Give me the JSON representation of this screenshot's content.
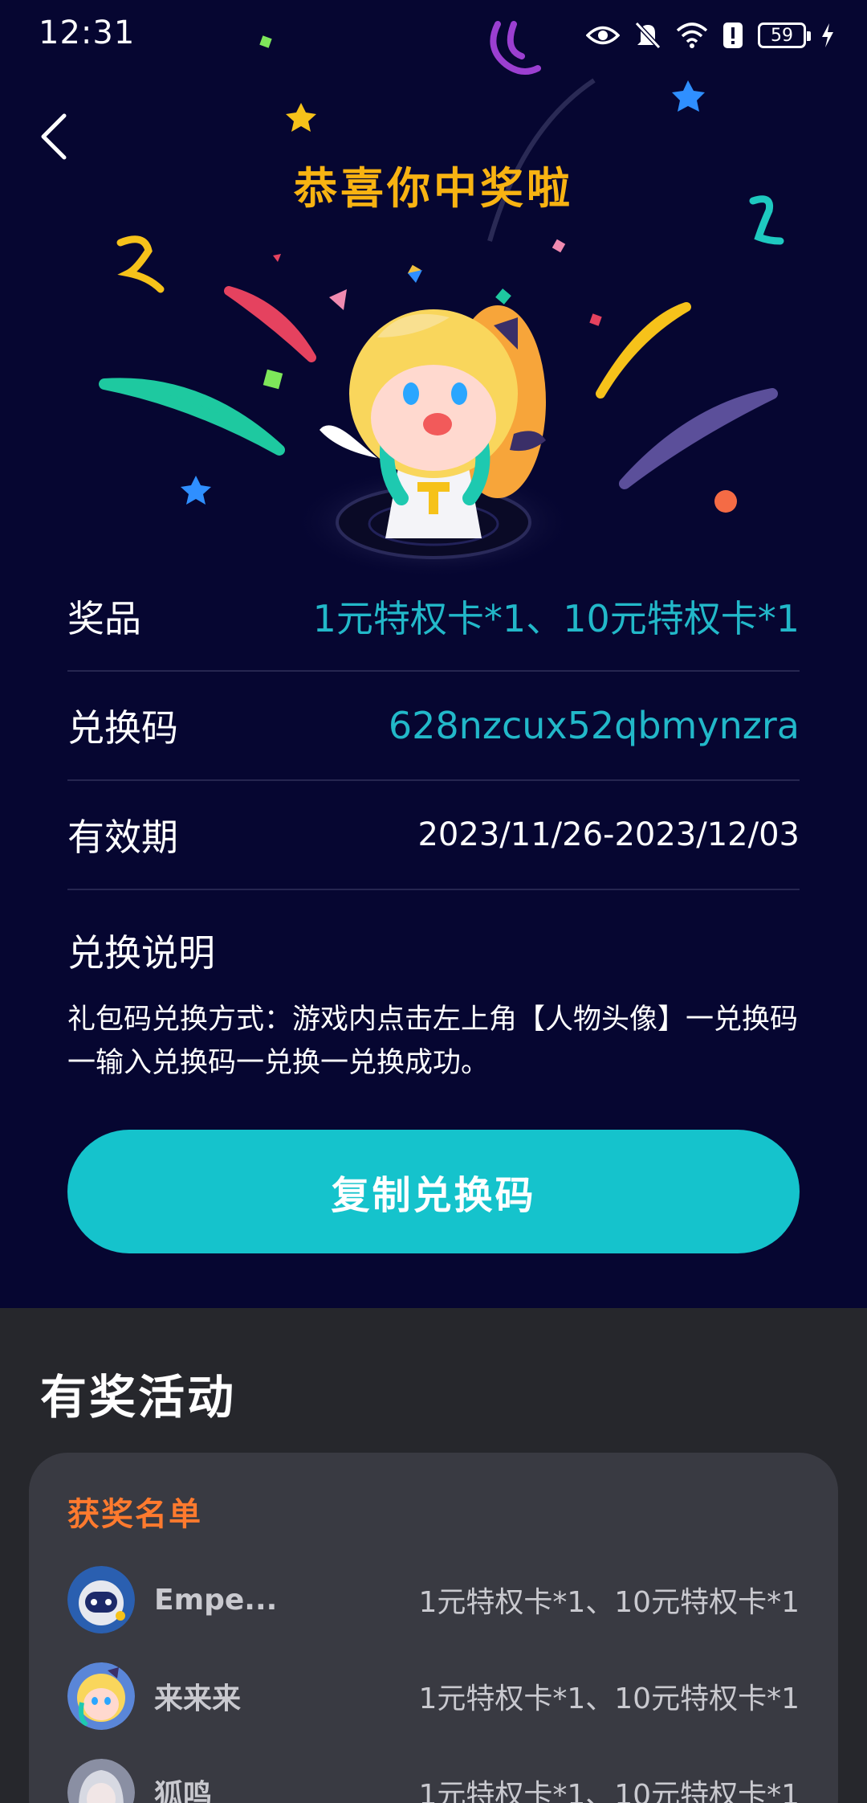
{
  "status_bar": {
    "time": "12:31",
    "battery": "59",
    "icons": [
      "eye-icon",
      "bell-muted-icon",
      "wifi-icon",
      "alert-icon",
      "battery-icon",
      "charging-icon"
    ]
  },
  "header": {
    "title": "恭喜你中奖啦"
  },
  "prize_info": {
    "prize_label": "奖品",
    "prize_value": "1元特权卡*1、10元特权卡*1",
    "code_label": "兑换码",
    "code_value": "628nzcux52qbmynzra",
    "validity_label": "有效期",
    "validity_value": "2023/11/26-2023/12/03",
    "instructions_title": "兑换说明",
    "instructions_text": "礼包码兑换方式：游戏内点击左上角【人物头像】一兑换码一输入兑换码一兑换一兑换成功。"
  },
  "copy_button_label": "复制兑换码",
  "activities": {
    "title": "有奖活动",
    "winners_title": "获奖名单",
    "winners": [
      {
        "name": "Empe...",
        "prize": "1元特权卡*1、10元特权卡*1"
      },
      {
        "name": "来来来",
        "prize": "1元特权卡*1、10元特权卡*1"
      },
      {
        "name": "狐鸣",
        "prize": "1元特权卡*1、10元特权卡*1"
      }
    ]
  },
  "colors": {
    "background": "#060631",
    "title_gold": "#f8b312",
    "accent_teal": "#15c3cc",
    "value_teal": "#22b8c9",
    "winners_orange": "#ff7a2e",
    "bottom_bg": "#26272c",
    "card_bg": "#393a42"
  }
}
